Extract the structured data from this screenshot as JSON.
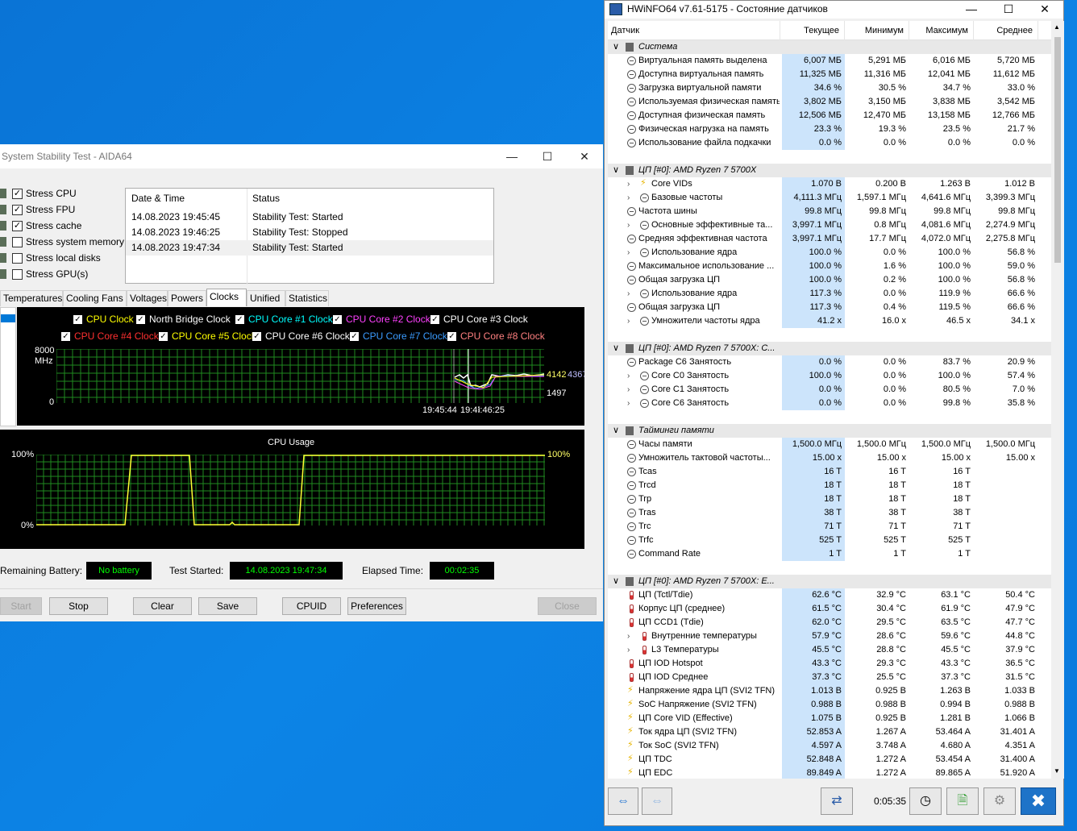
{
  "aida": {
    "title": "System Stability Test - AIDA64",
    "stress": [
      {
        "label": "Stress CPU",
        "checked": true
      },
      {
        "label": "Stress FPU",
        "checked": true
      },
      {
        "label": "Stress cache",
        "checked": true
      },
      {
        "label": "Stress system memory",
        "checked": false
      },
      {
        "label": "Stress local disks",
        "checked": false
      },
      {
        "label": "Stress GPU(s)",
        "checked": false
      }
    ],
    "log_headers": {
      "date": "Date & Time",
      "status": "Status"
    },
    "log": [
      {
        "date": "14.08.2023 19:45:45",
        "status": "Stability Test: Started"
      },
      {
        "date": "14.08.2023 19:46:25",
        "status": "Stability Test: Stopped"
      },
      {
        "date": "14.08.2023 19:47:34",
        "status": "Stability Test: Started"
      }
    ],
    "tabs": [
      "Temperatures",
      "Cooling Fans",
      "Voltages",
      "Powers",
      "Clocks",
      "Unified",
      "Statistics"
    ],
    "active_tab": "Clocks",
    "clock_legend": [
      {
        "label": "CPU Clock",
        "color": "#ffff00"
      },
      {
        "label": "North Bridge Clock",
        "color": "#ffffff"
      },
      {
        "label": "CPU Core #1 Clock",
        "color": "#00ffff"
      },
      {
        "label": "CPU Core #2 Clock",
        "color": "#ff40ff"
      },
      {
        "label": "CPU Core #3 Clock",
        "color": "#ffffff"
      },
      {
        "label": "CPU Core #4 Clock",
        "color": "#ff3030"
      },
      {
        "label": "CPU Core #5 Clock",
        "color": "#ffff00"
      },
      {
        "label": "CPU Core #6 Clock",
        "color": "#ffffff"
      },
      {
        "label": "CPU Core #7 Clock",
        "color": "#3b9cff"
      },
      {
        "label": "CPU Core #8 Clock",
        "color": "#ff8080"
      }
    ],
    "clock_chart": {
      "ymax_label": "8000",
      "unit_label": "MHz",
      "ymin_label": "0",
      "right_label_1": "4142",
      "right_label_2": "4367",
      "right_label_3": "1497",
      "time_label_1": "19:45:44",
      "time_label_2": "19:47:34",
      "time_label_3": "19:46:25"
    },
    "usage_chart": {
      "title": "CPU Usage",
      "ymax_label": "100%",
      "ymin_label": "0%",
      "right_label": "100%"
    },
    "status": {
      "battery_label": "Remaining Battery:",
      "battery_value": "No battery",
      "started_label": "Test Started:",
      "started_value": "14.08.2023 19:47:34",
      "elapsed_label": "Elapsed Time:",
      "elapsed_value": "00:02:35"
    },
    "buttons": {
      "start": "Start",
      "stop": "Stop",
      "clear": "Clear",
      "save": "Save",
      "cpuid": "CPUID",
      "preferences": "Preferences",
      "close": "Close"
    }
  },
  "hwinfo": {
    "title": "HWiNFO64 v7.61-5175 - Состояние датчиков",
    "columns": [
      "Датчик",
      "Текущее",
      "Минимум",
      "Максимум",
      "Среднее"
    ],
    "groups": [
      {
        "name": "Система",
        "rows": [
          {
            "n": "Виртуальная память выделена",
            "v": [
              "6,007 МБ",
              "5,291 МБ",
              "6,016 МБ",
              "5,720 МБ"
            ]
          },
          {
            "n": "Доступна виртуальная память",
            "v": [
              "11,325 МБ",
              "11,316 МБ",
              "12,041 МБ",
              "11,612 МБ"
            ]
          },
          {
            "n": "Загрузка виртуальной памяти",
            "v": [
              "34.6 %",
              "30.5 %",
              "34.7 %",
              "33.0 %"
            ]
          },
          {
            "n": "Используемая физическая память",
            "v": [
              "3,802 МБ",
              "3,150 МБ",
              "3,838 МБ",
              "3,542 МБ"
            ]
          },
          {
            "n": "Доступная физическая память",
            "v": [
              "12,506 МБ",
              "12,470 МБ",
              "13,158 МБ",
              "12,766 МБ"
            ]
          },
          {
            "n": "Физическая нагрузка на память",
            "v": [
              "23.3 %",
              "19.3 %",
              "23.5 %",
              "21.7 %"
            ]
          },
          {
            "n": "Использование файла подкачки",
            "v": [
              "0.0 %",
              "0.0 %",
              "0.0 %",
              "0.0 %"
            ]
          }
        ]
      },
      {
        "name": "ЦП [#0]: AMD Ryzen 7 5700X",
        "rows": [
          {
            "n": "Core VIDs",
            "v": [
              "1.070 В",
              "0.200 В",
              "1.263 В",
              "1.012 В"
            ],
            "ex": true,
            "icon": "bolt"
          },
          {
            "n": "Базовые частоты",
            "v": [
              "4,111.3 МГц",
              "1,597.1 МГц",
              "4,641.6 МГц",
              "3,399.3 МГц"
            ],
            "ex": true
          },
          {
            "n": "Частота шины",
            "v": [
              "99.8 МГц",
              "99.8 МГц",
              "99.8 МГц",
              "99.8 МГц"
            ]
          },
          {
            "n": "Основные эффективные та...",
            "v": [
              "3,997.1 МГц",
              "0.8 МГц",
              "4,081.6 МГц",
              "2,274.9 МГц"
            ],
            "ex": true
          },
          {
            "n": "Средняя эффективная частота",
            "v": [
              "3,997.1 МГц",
              "17.7 МГц",
              "4,072.0 МГц",
              "2,275.8 МГц"
            ]
          },
          {
            "n": "Использование ядра",
            "v": [
              "100.0 %",
              "0.0 %",
              "100.0 %",
              "56.8 %"
            ],
            "ex": true
          },
          {
            "n": "Максимальное использование ...",
            "v": [
              "100.0 %",
              "1.6 %",
              "100.0 %",
              "59.0 %"
            ]
          },
          {
            "n": "Общая загрузка ЦП",
            "v": [
              "100.0 %",
              "0.2 %",
              "100.0 %",
              "56.8 %"
            ]
          },
          {
            "n": "Использование ядра",
            "v": [
              "117.3 %",
              "0.0 %",
              "119.9 %",
              "66.6 %"
            ],
            "ex": true
          },
          {
            "n": "Общая загрузка ЦП",
            "v": [
              "117.3 %",
              "0.4 %",
              "119.5 %",
              "66.6 %"
            ]
          },
          {
            "n": "Умножители частоты ядра",
            "v": [
              "41.2 x",
              "16.0 x",
              "46.5 x",
              "34.1 x"
            ],
            "ex": true
          }
        ]
      },
      {
        "name": "ЦП [#0]: AMD Ryzen 7 5700X: C...",
        "rows": [
          {
            "n": "Package C6 Занятость",
            "v": [
              "0.0 %",
              "0.0 %",
              "83.7 %",
              "20.9 %"
            ]
          },
          {
            "n": "Core C0 Занятость",
            "v": [
              "100.0 %",
              "0.0 %",
              "100.0 %",
              "57.4 %"
            ],
            "ex": true
          },
          {
            "n": "Core C1 Занятость",
            "v": [
              "0.0 %",
              "0.0 %",
              "80.5 %",
              "7.0 %"
            ],
            "ex": true
          },
          {
            "n": "Core C6 Занятость",
            "v": [
              "0.0 %",
              "0.0 %",
              "99.8 %",
              "35.8 %"
            ],
            "ex": true
          }
        ]
      },
      {
        "name": "Тайминги памяти",
        "rows": [
          {
            "n": "Часы памяти",
            "v": [
              "1,500.0 МГц",
              "1,500.0 МГц",
              "1,500.0 МГц",
              "1,500.0 МГц"
            ]
          },
          {
            "n": "Умножитель тактовой частоты...",
            "v": [
              "15.00 x",
              "15.00 x",
              "15.00 x",
              "15.00 x"
            ]
          },
          {
            "n": "Tcas",
            "v": [
              "16 T",
              "16 T",
              "16 T",
              ""
            ]
          },
          {
            "n": "Trcd",
            "v": [
              "18 T",
              "18 T",
              "18 T",
              ""
            ]
          },
          {
            "n": "Trp",
            "v": [
              "18 T",
              "18 T",
              "18 T",
              ""
            ]
          },
          {
            "n": "Tras",
            "v": [
              "38 T",
              "38 T",
              "38 T",
              ""
            ]
          },
          {
            "n": "Trc",
            "v": [
              "71 T",
              "71 T",
              "71 T",
              ""
            ]
          },
          {
            "n": "Trfc",
            "v": [
              "525 T",
              "525 T",
              "525 T",
              ""
            ]
          },
          {
            "n": "Command Rate",
            "v": [
              "1 T",
              "1 T",
              "1 T",
              ""
            ]
          }
        ]
      },
      {
        "name": "ЦП [#0]: AMD Ryzen 7 5700X: E...",
        "rows": [
          {
            "n": "ЦП (Tctl/Tdie)",
            "v": [
              "62.6 °C",
              "32.9 °C",
              "63.1 °C",
              "50.4 °C"
            ],
            "icon": "therm"
          },
          {
            "n": "Корпус ЦП (среднее)",
            "v": [
              "61.5 °C",
              "30.4 °C",
              "61.9 °C",
              "47.9 °C"
            ],
            "icon": "therm"
          },
          {
            "n": "ЦП CCD1 (Tdie)",
            "v": [
              "62.0 °C",
              "29.5 °C",
              "63.5 °C",
              "47.7 °C"
            ],
            "icon": "therm"
          },
          {
            "n": "Внутренние температуры",
            "v": [
              "57.9 °C",
              "28.6 °C",
              "59.6 °C",
              "44.8 °C"
            ],
            "icon": "therm",
            "ex": true
          },
          {
            "n": "L3 Температуры",
            "v": [
              "45.5 °C",
              "28.8 °C",
              "45.5 °C",
              "37.9 °C"
            ],
            "icon": "therm",
            "ex": true
          },
          {
            "n": "ЦП IOD Hotspot",
            "v": [
              "43.3 °C",
              "29.3 °C",
              "43.3 °C",
              "36.5 °C"
            ],
            "icon": "therm"
          },
          {
            "n": "ЦП IOD Среднее",
            "v": [
              "37.3 °C",
              "25.5 °C",
              "37.3 °C",
              "31.5 °C"
            ],
            "icon": "therm"
          },
          {
            "n": "Напряжение ядра ЦП (SVI2 TFN)",
            "v": [
              "1.013 В",
              "0.925 В",
              "1.263 В",
              "1.033 В"
            ],
            "icon": "bolt"
          },
          {
            "n": "SoC Напряжение (SVI2 TFN)",
            "v": [
              "0.988 В",
              "0.988 В",
              "0.994 В",
              "0.988 В"
            ],
            "icon": "bolt"
          },
          {
            "n": "ЦП Core VID (Effective)",
            "v": [
              "1.075 В",
              "0.925 В",
              "1.281 В",
              "1.066 В"
            ],
            "icon": "bolt"
          },
          {
            "n": "Ток ядра ЦП (SVI2 TFN)",
            "v": [
              "52.853 A",
              "1.267 A",
              "53.464 A",
              "31.401 A"
            ],
            "icon": "bolt"
          },
          {
            "n": "Ток SoC (SVI2 TFN)",
            "v": [
              "4.597 A",
              "3.748 A",
              "4.680 A",
              "4.351 A"
            ],
            "icon": "bolt"
          },
          {
            "n": "ЦП TDC",
            "v": [
              "52.848 A",
              "1.272 A",
              "53.454 A",
              "31.400 A"
            ],
            "icon": "bolt"
          },
          {
            "n": "ЦП EDC",
            "v": [
              "89.849 A",
              "1.272 A",
              "89.865 A",
              "51.920 A"
            ],
            "icon": "bolt"
          }
        ]
      }
    ],
    "footer_time": "0:05:35"
  }
}
